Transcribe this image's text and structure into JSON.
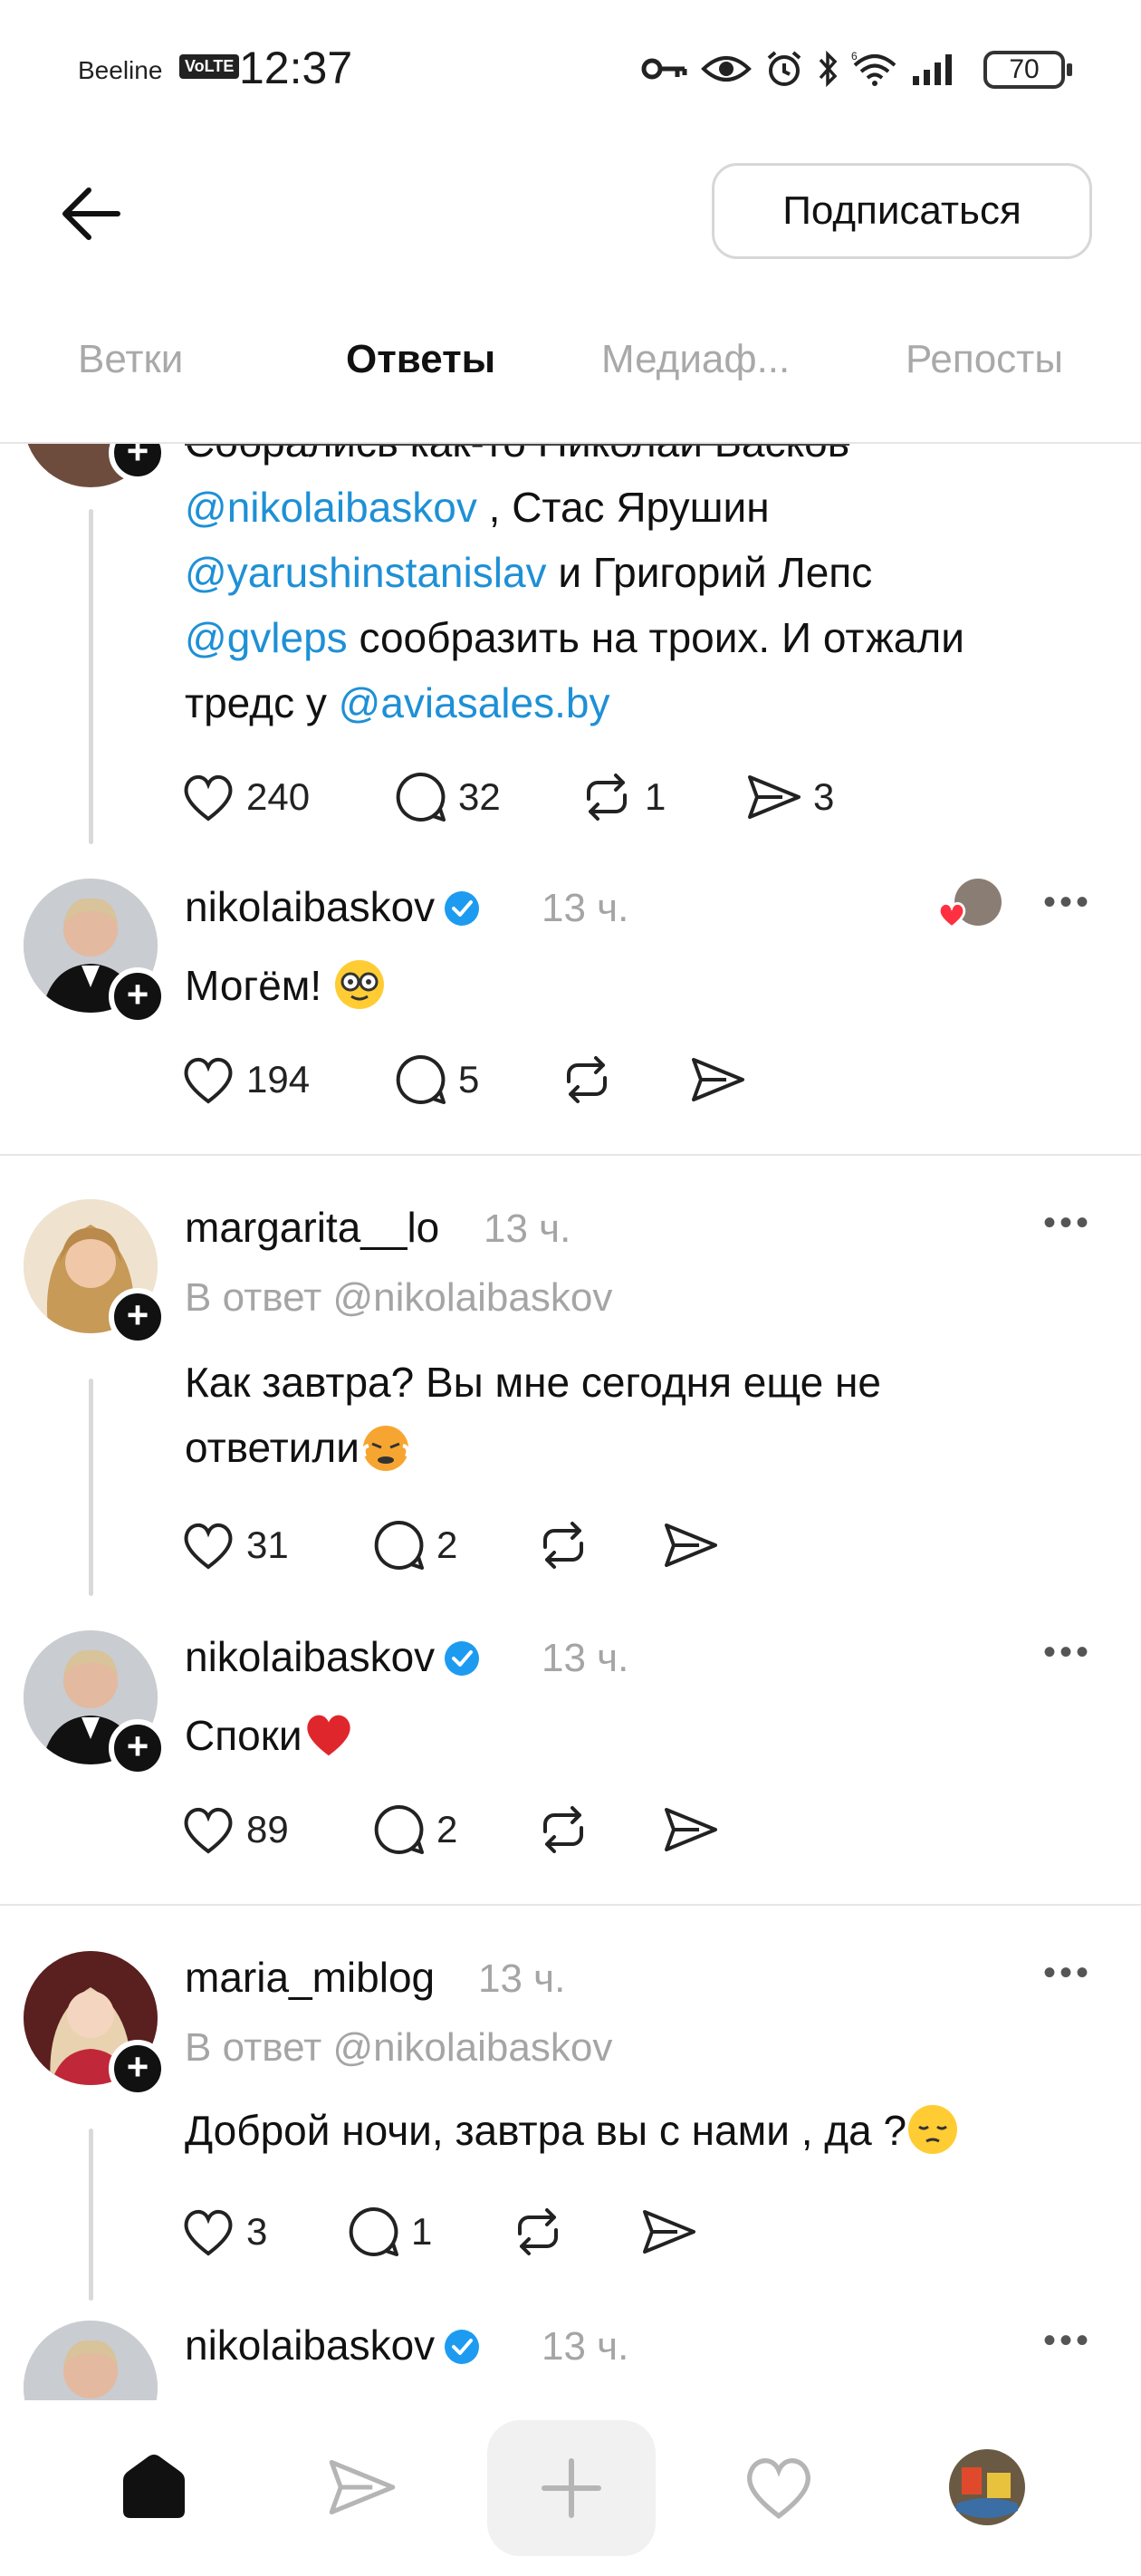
{
  "status": {
    "carrier": "Beeline",
    "volte": "VoLTE",
    "time": "12:37",
    "battery": "70"
  },
  "header": {
    "subscribe_label": "Подписаться"
  },
  "tabs": [
    {
      "label": "Ветки"
    },
    {
      "label": "Ответы"
    },
    {
      "label": "Медиаф..."
    },
    {
      "label": "Репосты"
    }
  ],
  "posts": {
    "first": {
      "line_top": "Собрались как-то Николай Басков",
      "mention1": "@nikolaibaskov",
      "text1": ", Стас Ярушин",
      "mention2": "@yarushinstanislav",
      "text2": "и Григорий Лепс",
      "mention3": "@gvleps",
      "text3": "сообразить на троих. И отжали",
      "text4": "тредс у",
      "mention4": "@aviasales.by",
      "likes": "240",
      "replies": "32",
      "reposts": "1",
      "shares": "3"
    },
    "p2": {
      "username": "nikolaibaskov",
      "time": "13 ч.",
      "text": "Могём!",
      "likes": "194",
      "replies": "5"
    },
    "p3": {
      "username": "margarita__lo",
      "time": "13 ч.",
      "reply_to": "В ответ @nikolaibaskov",
      "text_line1": "Как завтра? Вы мне сегодня еще не",
      "text_line2": "ответили",
      "likes": "31",
      "replies": "2"
    },
    "p4": {
      "username": "nikolaibaskov",
      "time": "13 ч.",
      "text": "Споки",
      "likes": "89",
      "replies": "2"
    },
    "p5": {
      "username": "maria_miblog",
      "time": "13 ч.",
      "reply_to": "В ответ @nikolaibaskov",
      "text": "Доброй ночи, завтра вы с нами , да ?",
      "likes": "3",
      "replies": "1"
    },
    "p6": {
      "username": "nikolaibaskov",
      "time": "13 ч."
    }
  },
  "colors": {
    "mention": "#1e90d6",
    "verified": "#1d9bf0",
    "muted": "#a5a5a5"
  },
  "icons": [
    "back-arrow-icon",
    "heart-icon",
    "comment-icon",
    "repost-icon",
    "share-icon",
    "more-icon",
    "verified-icon",
    "home-icon",
    "plus-icon"
  ]
}
